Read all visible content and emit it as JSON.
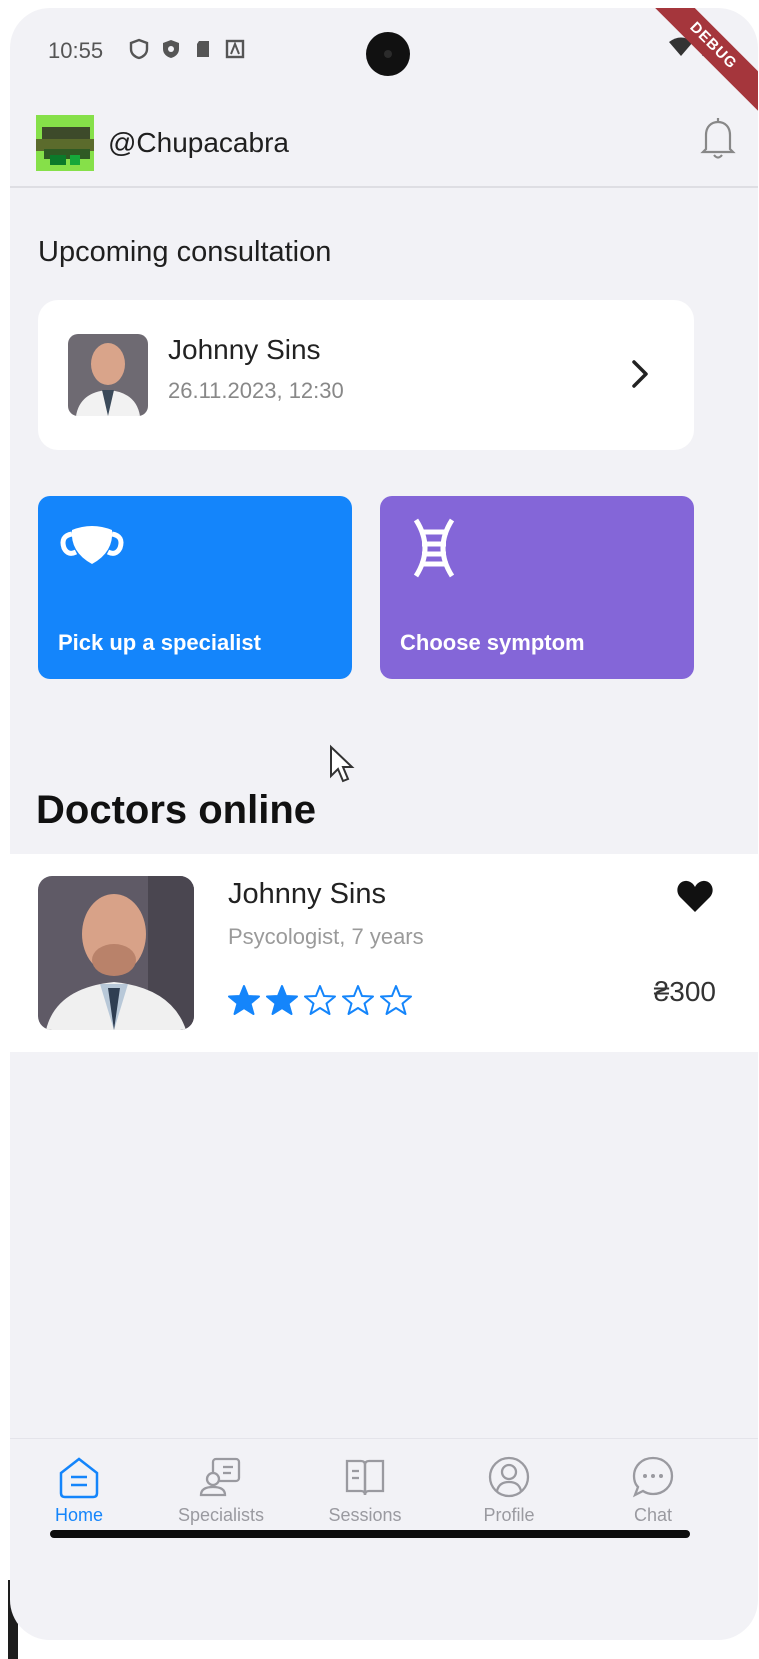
{
  "status_bar": {
    "time": "10:55",
    "debug_label": "DEBUG"
  },
  "header": {
    "username": "@Chupacabra"
  },
  "upcoming": {
    "title": "Upcoming consultation",
    "doctor_name": "Johnny Sins",
    "datetime": "26.11.2023, 12:30"
  },
  "actions": [
    {
      "label": "Pick up a specialist",
      "icon": "medical-mask-icon",
      "color": "#1485fb"
    },
    {
      "label": "Choose symptom",
      "icon": "dna-icon",
      "color": "#8466d8"
    }
  ],
  "doctors_online": {
    "title": "Doctors online",
    "items": [
      {
        "name": "Johnny Sins",
        "subtitle": "Psycologist, 7 years",
        "rating": 2,
        "rating_max": 5,
        "price": "₴300"
      }
    ]
  },
  "bottom_nav": {
    "items": [
      {
        "label": "Home",
        "icon": "home-icon",
        "active": true
      },
      {
        "label": "Specialists",
        "icon": "specialists-icon",
        "active": false
      },
      {
        "label": "Sessions",
        "icon": "book-icon",
        "active": false
      },
      {
        "label": "Profile",
        "icon": "profile-icon",
        "active": false
      },
      {
        "label": "Chat",
        "icon": "chat-icon",
        "active": false
      }
    ]
  },
  "colors": {
    "accent": "#1485fb",
    "purple": "#8466d8",
    "background": "#f2f2f6"
  }
}
